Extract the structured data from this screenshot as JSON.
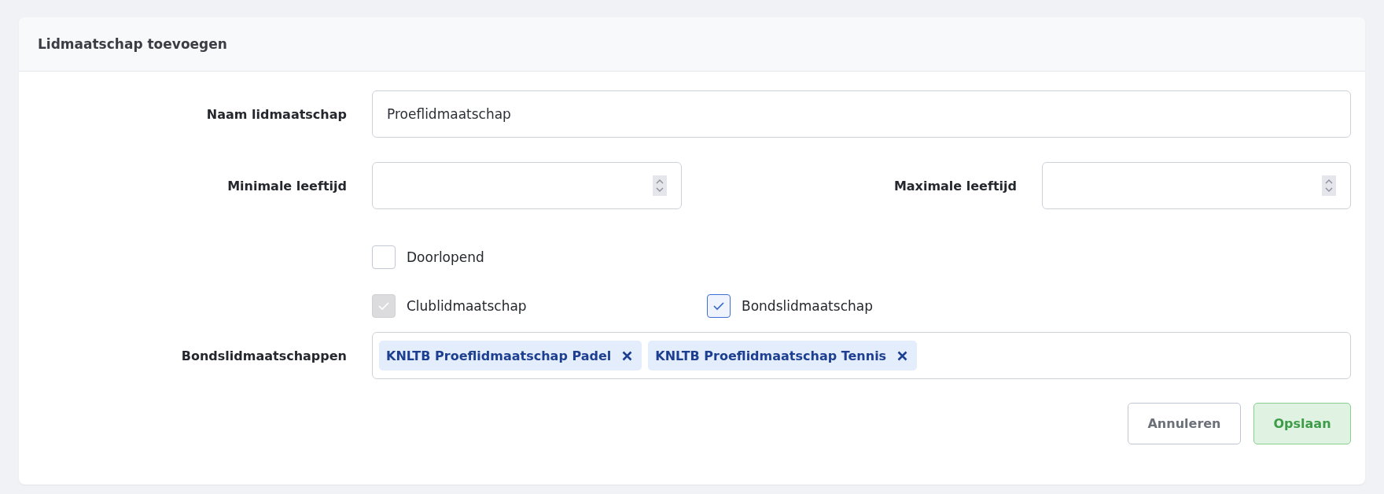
{
  "card": {
    "title": "Lidmaatschap toevoegen"
  },
  "name_field": {
    "label": "Naam lidmaatschap",
    "value": "Proeflidmaatschap"
  },
  "age_fields": [
    {
      "label": "Minimale leeftijd"
    },
    {
      "label": "Maximale leeftijd"
    }
  ],
  "checkboxes": [
    {
      "label": "Doorlopend",
      "checked": false,
      "disabled": false
    },
    {
      "label": "Clublidmaatschap",
      "checked": true,
      "disabled": true
    },
    {
      "label": "Bondslidmaatschap",
      "checked": true,
      "disabled": false
    }
  ],
  "federation_field": {
    "label": "Bondslidmaatschappen",
    "tags": [
      "KNLTB Proeflidmaatschap Padel",
      "KNLTB Proeflidmaatschap Tennis"
    ]
  },
  "buttons": [
    {
      "label": "Annuleren",
      "kind": "secondary"
    },
    {
      "label": "Opslaan",
      "kind": "primary"
    }
  ]
}
